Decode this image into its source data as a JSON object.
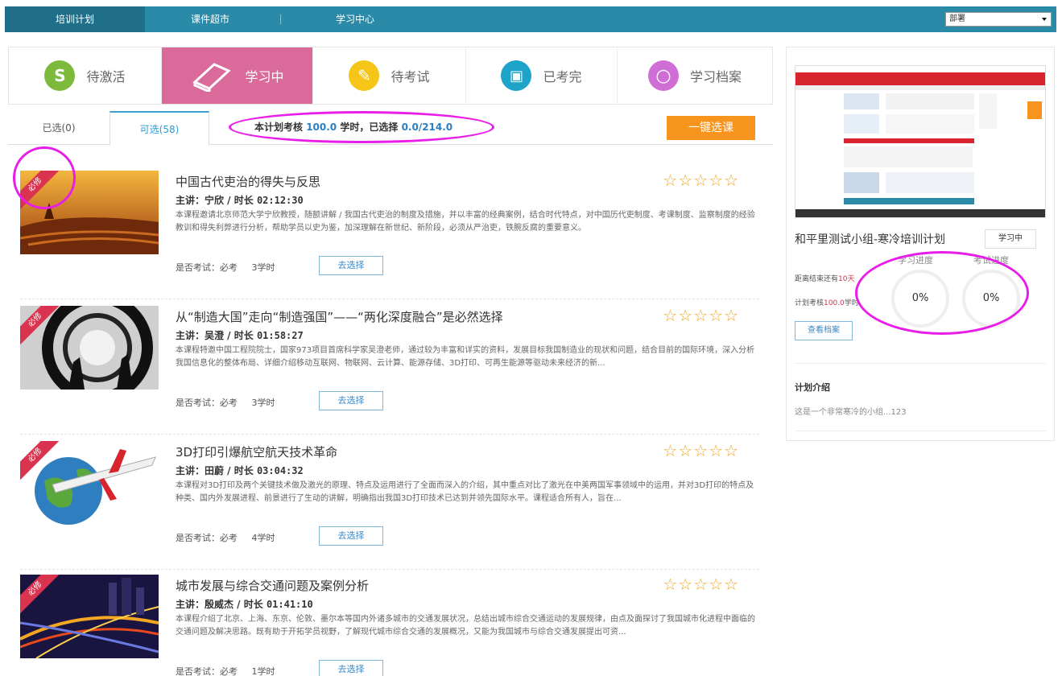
{
  "nav": {
    "tabs": [
      "培训计划",
      "课件超市",
      "学习中心"
    ],
    "select_value": "部署"
  },
  "status_tabs": [
    {
      "label": "待激活",
      "icon": "dollar-icon",
      "glyph": "S",
      "color": "#7dba3b"
    },
    {
      "label": "学习中",
      "icon": "book-icon",
      "glyph": "",
      "color": "#d96a99"
    },
    {
      "label": "待考试",
      "icon": "pencil-icon",
      "glyph": "✎",
      "color": "#f5c518"
    },
    {
      "label": "已考完",
      "icon": "screen-check-icon",
      "glyph": "▣",
      "color": "#1ea4c8"
    },
    {
      "label": "学习档案",
      "icon": "magnifier-icon",
      "glyph": "○",
      "color": "#cf6fd6"
    }
  ],
  "subtabs": {
    "selected": "已选(0)",
    "available": "可选(58)"
  },
  "summary": {
    "prefix": "本计划考核",
    "required_hours": "100.0",
    "middle": "学时，已选择",
    "selected_hours": "0.0/214.0"
  },
  "oneclick_label": "一键选课",
  "courses": [
    {
      "ribbon": "必修",
      "title": "中国古代吏治的得失与反思",
      "meta_prefix": "主讲：宁欣 / 时长",
      "duration": "02:12:30",
      "desc": "本课程邀请北京师范大学宁欣教授，随额讲解 / 我国古代吏治的制度及措施，并以丰富的经典案例，结合时代特点，对中国历代吏制度、考课制度、监察制度的经验教训和得失利弊进行分析，帮助学员以史为鉴，加深理解在新世纪、新阶段，必须从严治吏，铁腕反腐的重要意义。",
      "exam_label": "是否考试：必考",
      "hours": "3学时",
      "pick_label": "去选择",
      "stars": "☆☆☆☆☆"
    },
    {
      "ribbon": "必修",
      "title": "从“制造大国”走向“制造强国”——“两化深度融合”是必然选择",
      "meta_prefix": "主讲：吴澄 / 时长",
      "duration": "01:58:27",
      "desc": "本课程特邀中国工程院院士，国家973项目首席科学家吴澄老师，通过较为丰富和详实的资料，发展目标我国制造业的现状和问题，结合目前的国际环境，深入分析我国信息化的整体布局、详细介绍移动互联网、物联网、云计算、能源存储、3D打印、可再生能源等驱动未来经济的新...",
      "exam_label": "是否考试：必考",
      "hours": "3学时",
      "pick_label": "去选择",
      "stars": "☆☆☆☆☆"
    },
    {
      "ribbon": "必修",
      "title": "3D打印引爆航空航天技术革命",
      "meta_prefix": "主讲：田蔚 / 时长",
      "duration": "03:04:32",
      "desc": "本课程对3D打印及两个关键技术做及激光的原理、特点及运用进行了全面而深入的介绍，其中重点对比了激光在中美两国军事领域中的运用，并对3D打印的特点及种类、国内外发展进程、前景进行了生动的讲解，明确指出我国3D打印技术已达到并领先国际水平。课程适合所有人，旨在...",
      "exam_label": "是否考试：必考",
      "hours": "4学时",
      "pick_label": "去选择",
      "stars": "☆☆☆☆☆"
    },
    {
      "ribbon": "必修",
      "title": "城市发展与综合交通问题及案例分析",
      "meta_prefix": "主讲：殷威杰 / 时长",
      "duration": "01:41:10",
      "desc": "本课程介绍了北京、上海、东京、伦敦、墨尔本等国内外诸多城市的交通发展状况，总结出城市综合交通运动的发展规律，由点及面探讨了我国城市化进程中面临的交通问题及解决思路。既有助于开拓学员视野，了解现代城市综合交通的发展概况，又能为我国城市与综合交通发展提出可资...",
      "exam_label": "是否考试：必考",
      "hours": "1学时",
      "pick_label": "去选择",
      "stars": "☆☆☆☆☆"
    }
  ],
  "panel": {
    "plan_title": "和平里测试小组-寒冷培训计划",
    "status_badge": "学习中",
    "study_progress_label": "学习进度",
    "exam_progress_label": "考试进度",
    "line1_prefix": "距离结束还有",
    "line1_value": "10天",
    "line2_prefix": "计划考核",
    "line2_value": "100.0",
    "line2_suffix": "学时",
    "study_progress_value": "0%",
    "exam_progress_value": "0%",
    "view_label": "查看档案",
    "intro_heading": "计划介绍",
    "intro_text": "这是一个非常寒冷的小组...123"
  },
  "colors": {
    "nav_bg": "#2a8aa8",
    "active_tab": "#d96a99",
    "oneclick": "#f7941d",
    "ribbon": "#d9334f",
    "stars": "#f6a623",
    "annotation": "#e81ee8"
  }
}
